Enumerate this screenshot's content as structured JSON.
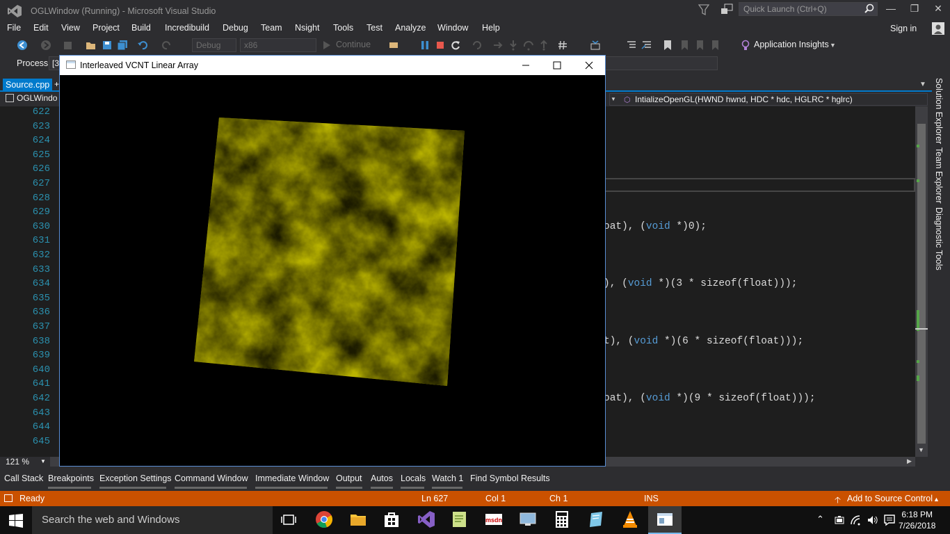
{
  "window": {
    "title": "OGLWindow (Running) - Microsoft Visual Studio",
    "quick_launch_placeholder": "Quick Launch (Ctrl+Q)"
  },
  "menu": [
    "File",
    "Edit",
    "View",
    "Project",
    "Build",
    "Incredibuild",
    "Debug",
    "Team",
    "Nsight",
    "Tools",
    "Test",
    "Analyze",
    "Window",
    "Help"
  ],
  "signin": "Sign in",
  "toolbar": {
    "config": "Debug",
    "platform": "x86",
    "continue_label": "Continue",
    "app_insights": "Application Insights"
  },
  "process": {
    "label": "Process:",
    "value": "[3"
  },
  "tabs": {
    "active": "Source.cpp",
    "pin": "+"
  },
  "nav": {
    "scope": "OGLWindo",
    "member": "IntializeOpenGL(HWND hwnd, HDC * hdc, HGLRC * hglrc)"
  },
  "editor": {
    "line_numbers": [
      "622",
      "623",
      "624",
      "625",
      "626",
      "627",
      "628",
      "629",
      "630",
      "631",
      "632",
      "633",
      "634",
      "635",
      "636",
      "637",
      "638",
      "639",
      "640",
      "641",
      "642",
      "643",
      "644",
      "645"
    ],
    "zoom": "121 %",
    "code_fragments": [
      {
        "line": "630",
        "pre": "oat), (",
        "kw": "void",
        "post": " *)0);"
      },
      {
        "line": "634",
        "pre": "), (",
        "kw": "void",
        "post": " *)(3 * sizeof(float)));"
      },
      {
        "line": "638",
        "pre": "t), (",
        "kw": "void",
        "post": " *)(6 * sizeof(float)));"
      },
      {
        "line": "642",
        "pre": "oat), (",
        "kw": "void",
        "post": " *)(9 * sizeof(float)));"
      }
    ]
  },
  "side_tabs": [
    "Solution Explorer",
    "Team Explorer",
    "Diagnostic Tools"
  ],
  "bottom_tabs": [
    "Call Stack",
    "Breakpoints",
    "Exception Settings",
    "Command Window",
    "Immediate Window",
    "Output",
    "Autos",
    "Locals",
    "Watch 1",
    "Find Symbol Results"
  ],
  "status": {
    "state": "Ready",
    "line": "Ln 627",
    "col": "Col 1",
    "ch": "Ch 1",
    "mode": "INS",
    "source_control": "Add to Source Control"
  },
  "gl_window": {
    "title": "Interleaved VCNT Linear Array",
    "texture_color": "#b5b000"
  },
  "taskbar": {
    "search_placeholder": "Search the web and Windows",
    "time": "6:18 PM",
    "date": "7/26/2018"
  },
  "colors": {
    "accent": "#007acc",
    "statusbar": "#ca5100",
    "editor_bg": "#1e1e1e"
  }
}
